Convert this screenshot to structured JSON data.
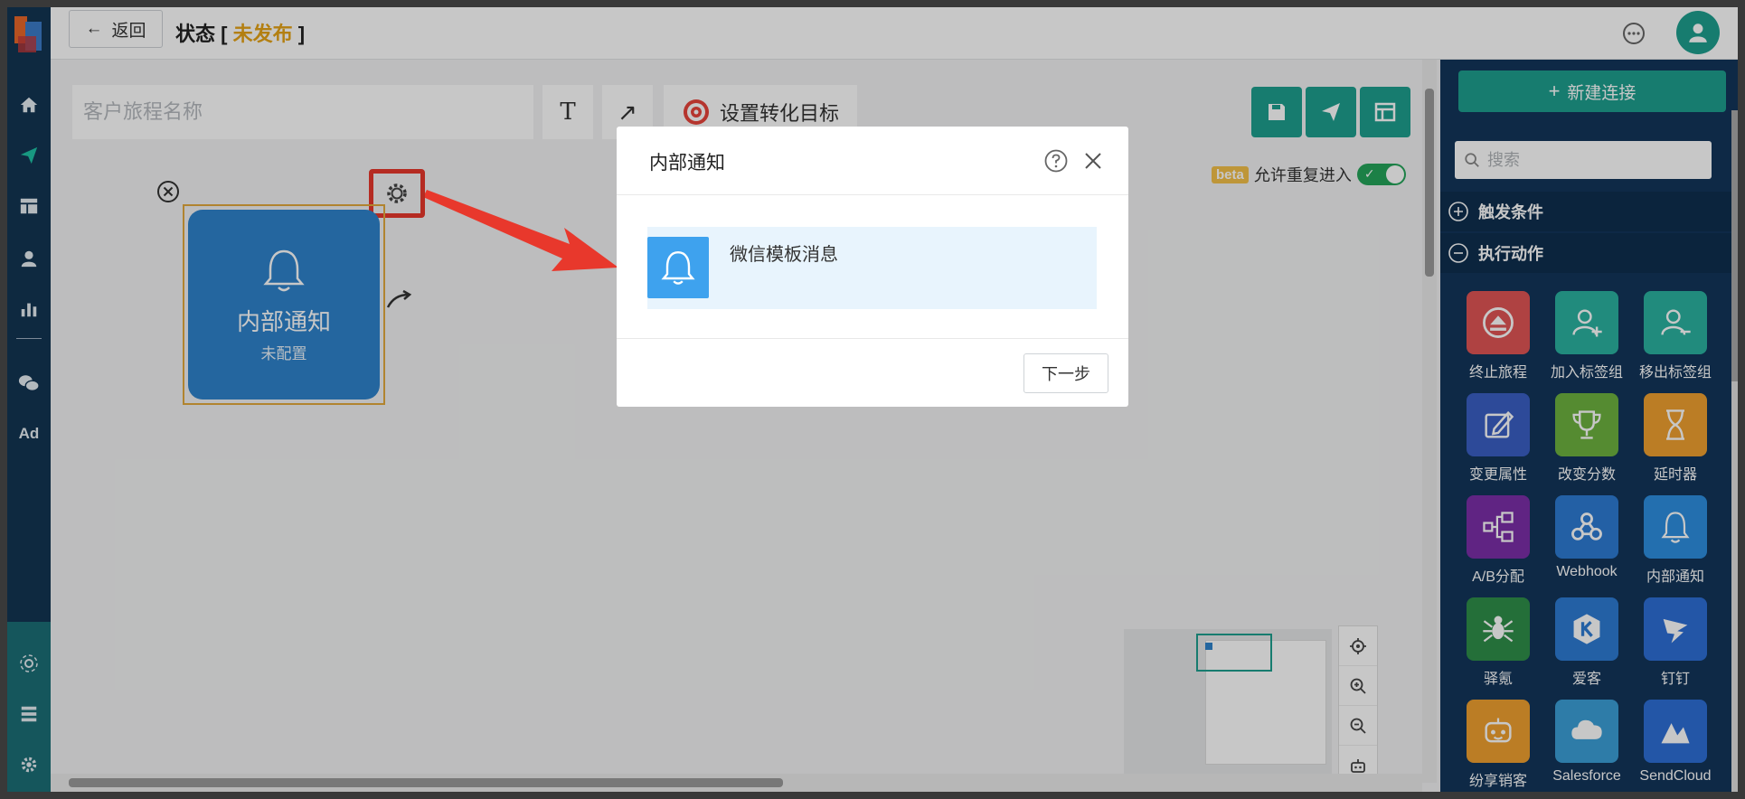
{
  "header": {
    "back_label": "返回",
    "title_prefix": "状态",
    "bracket_open": "[",
    "status": "未发布",
    "bracket_close": "]"
  },
  "toolbar": {
    "name_placeholder": "客户旅程名称",
    "text_tool": "T",
    "arrow_tool": "↗",
    "goal_label": "设置转化目标"
  },
  "canvas": {
    "beta_badge": "beta",
    "allow_reentry_label": "允许重复进入",
    "allow_reentry_on": true,
    "node": {
      "title": "内部通知",
      "subtitle": "未配置"
    }
  },
  "right_panel": {
    "new_connection_label": "新建连接",
    "search_placeholder": "搜索",
    "sections": [
      {
        "label": "触发条件",
        "expanded": false
      },
      {
        "label": "执行动作",
        "expanded": true
      }
    ],
    "tiles": [
      {
        "label": "终止旅程",
        "color": "#e05555",
        "icon": "stop-icon"
      },
      {
        "label": "加入标签组",
        "color": "#2bb3a0",
        "icon": "user-add-icon"
      },
      {
        "label": "移出标签组",
        "color": "#2bb3a0",
        "icon": "user-remove-icon"
      },
      {
        "label": "变更属性",
        "color": "#3a5fc4",
        "icon": "edit-icon"
      },
      {
        "label": "改变分数",
        "color": "#6db33f",
        "icon": "trophy-icon"
      },
      {
        "label": "延时器",
        "color": "#f0a030",
        "icon": "hourglass-icon"
      },
      {
        "label": "A/B分配",
        "color": "#7b2fa8",
        "icon": "split-icon"
      },
      {
        "label": "Webhook",
        "color": "#2d7bd4",
        "icon": "webhook-icon"
      },
      {
        "label": "内部通知",
        "color": "#2d8fe0",
        "icon": "bell-icon"
      },
      {
        "label": "驿氪",
        "color": "#2f8f4a",
        "icon": "spider-icon"
      },
      {
        "label": "爱客",
        "color": "#2d7bd4",
        "icon": "hexagon-k-icon"
      },
      {
        "label": "钉钉",
        "color": "#2d6fd6",
        "icon": "dingtalk-icon"
      },
      {
        "label": "纷享销客",
        "color": "#f0a030",
        "icon": "robot-icon"
      },
      {
        "label": "Salesforce",
        "color": "#3b9fd8",
        "icon": "cloud-icon"
      },
      {
        "label": "SendCloud",
        "color": "#2d6fd6",
        "icon": "sendcloud-icon"
      }
    ]
  },
  "modal": {
    "title": "内部通知",
    "option_label": "微信模板消息",
    "next_label": "下一步"
  },
  "colors": {
    "nav_bg": "#133553",
    "teal": "#1e9f8f",
    "status_orange": "#e6a317",
    "node_blue": "#2f83cc",
    "highlight_red": "#e8382c"
  }
}
